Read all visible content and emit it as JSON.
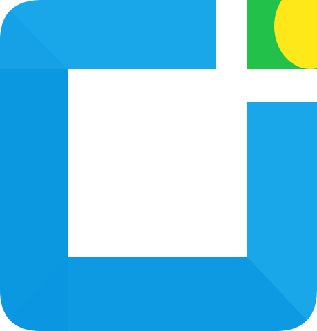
{
  "logo": {
    "icon_name": "app-logo-icon",
    "description_colors": {
      "frame_light": "#1aa7ea",
      "frame_dark": "#0a95df",
      "background": "#ffffff",
      "corner_green": "#22c24a",
      "corner_yellow": "#ffe81a"
    }
  }
}
